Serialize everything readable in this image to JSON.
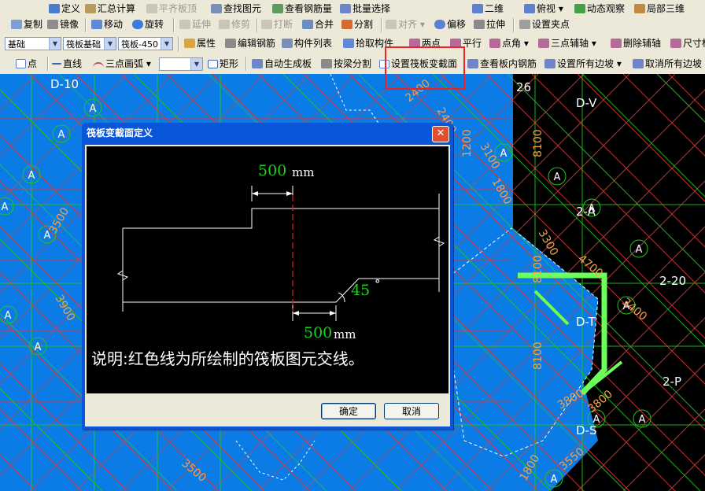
{
  "toolbar1": {
    "define": "定义",
    "calc": "汇总计算",
    "flush_top": "平齐板顶",
    "find": "查找图元",
    "view_rebar": "查看钢筋量",
    "batch_select": "批量选择",
    "view_mode": "二维",
    "view_angle": "俯视",
    "dyn_view": "动态观察",
    "local_3d": "局部三维"
  },
  "toolbar2": {
    "copy": "复制",
    "mirror": "镜像",
    "move": "移动",
    "rotate": "旋转",
    "extend": "延伸",
    "trim": "修剪",
    "break": "打断",
    "merge": "合并",
    "split": "分割",
    "align": "对齐",
    "offset": "偏移",
    "stretch": "拉伸",
    "set_grip": "设置夹点"
  },
  "toolbar3": {
    "layer": "基础",
    "type": "筏板基础",
    "element": "筏板-450",
    "props": "属性",
    "edit_rebar": "编辑钢筋",
    "component_list": "构件列表",
    "pick": "拾取构件",
    "two_points": "两点",
    "parallel": "平行",
    "point_angle": "点角",
    "three_point_axis": "三点辅轴",
    "delete_axis": "删除辅轴",
    "dimension": "尺寸标注"
  },
  "toolbar4": {
    "point": "点",
    "line": "直线",
    "arc": "三点画弧",
    "rect": "矩形",
    "auto_slab": "自动生成板",
    "split_beam": "按梁分割",
    "set_section": "设置筏板变截面",
    "view_inner": "查看板内钢筋",
    "set_edges": "设置所有边坡",
    "cancel_edges": "取消所有边坡"
  },
  "canvas_labels": {
    "grid_marks": [
      "A",
      "A",
      "A",
      "A",
      "A",
      "A",
      "A",
      "A",
      "A",
      "A",
      "A",
      "A",
      "A",
      "A",
      "A",
      "A",
      "A",
      "A"
    ],
    "dims": [
      "3500",
      "3900",
      "3500",
      "2400",
      "3100",
      "3300",
      "4700",
      "3400",
      "8100",
      "8100",
      "8100",
      "3800",
      "3800",
      "3550",
      "2400",
      "1800",
      "1800",
      "1200"
    ],
    "axis_labels": [
      "D-V",
      "2-A",
      "D-T",
      "2-20",
      "D-S",
      "2-P",
      "26",
      "D-10"
    ]
  },
  "dialog": {
    "title": "筏板变截面定义",
    "top_dim": "500",
    "bottom_dim": "500",
    "unit": "mm",
    "angle": "45",
    "degree": "°",
    "note": "说明:红色线为所绘制的筏板图元交线。",
    "ok": "确定",
    "cancel": "取消"
  },
  "colors": {
    "canvas_bg": "#0b7be6",
    "grid_red": "#e23a3a",
    "grid_green": "#1fc41f",
    "highlight_green": "#6cff5a",
    "dialog_title": "#0a56d8"
  }
}
